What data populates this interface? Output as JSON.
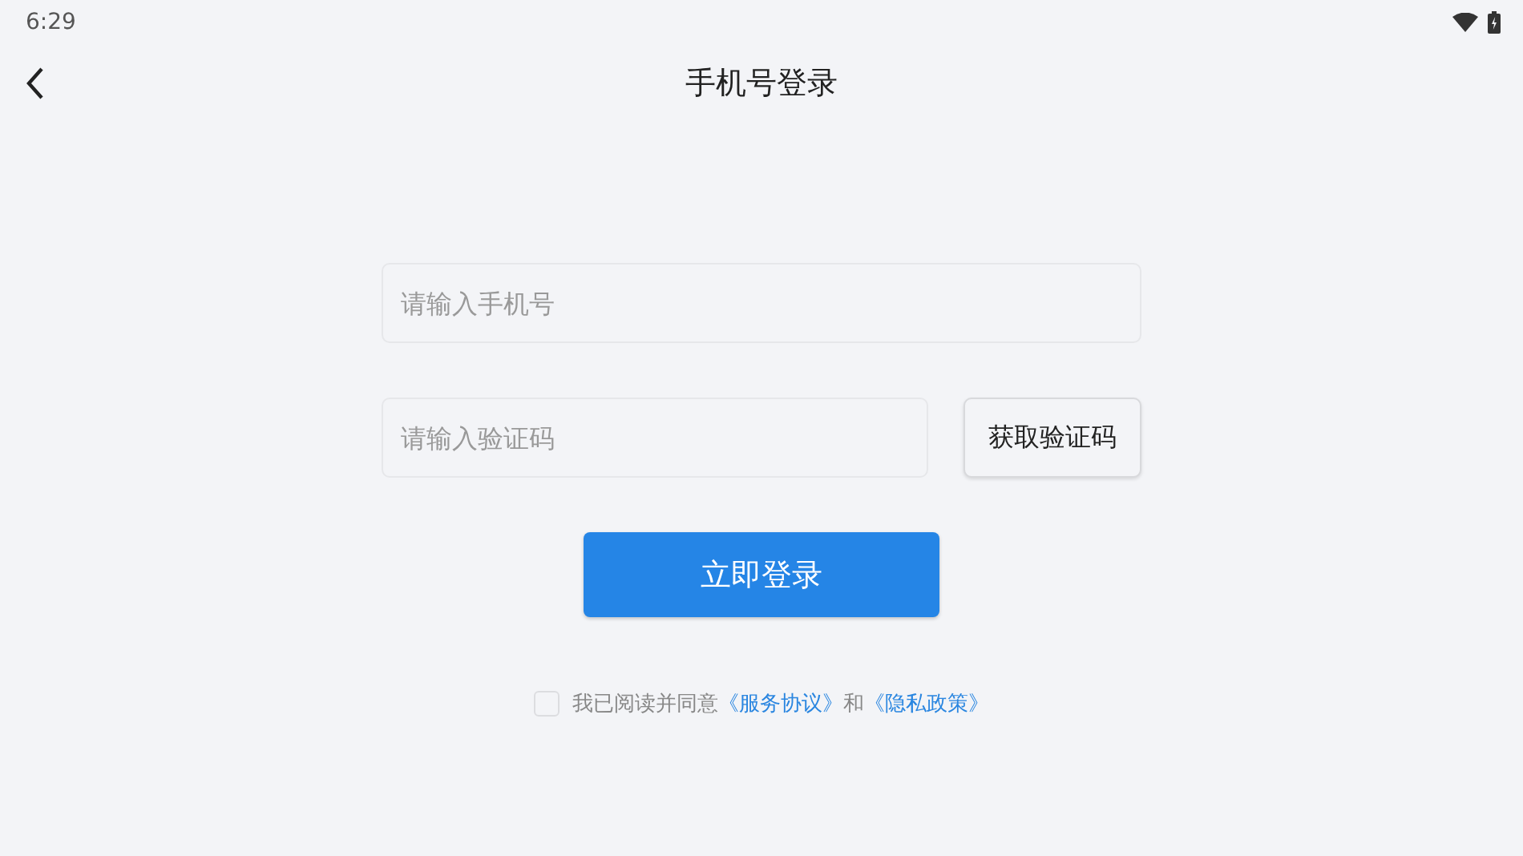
{
  "status_bar": {
    "time": "6:29"
  },
  "header": {
    "title": "手机号登录"
  },
  "phone_field": {
    "placeholder": "请输入手机号"
  },
  "code_field": {
    "placeholder": "请输入验证码"
  },
  "get_code_button": {
    "label": "获取验证码"
  },
  "login_button": {
    "label": "立即登录"
  },
  "agreement": {
    "checked": false,
    "text": "我已阅读并同意",
    "link_1": "《服务协议》",
    "joiner": "和",
    "link_2": "《隐私政策》"
  }
}
